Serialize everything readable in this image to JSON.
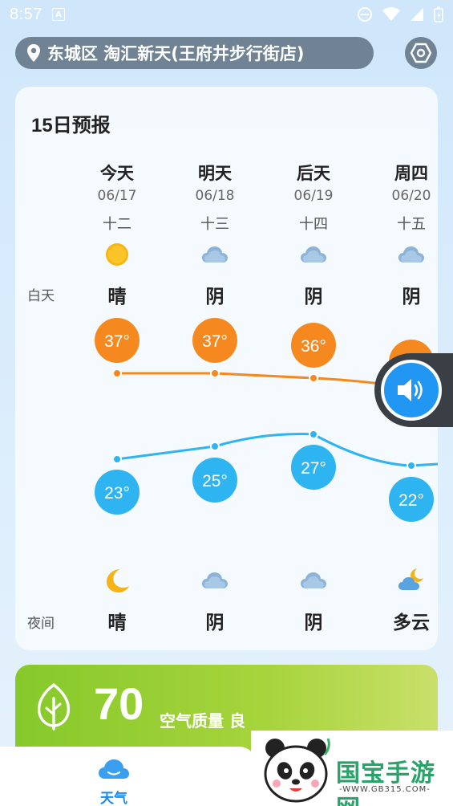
{
  "status": {
    "time": "8:57",
    "badge": "A"
  },
  "location": {
    "text": "东城区 淘汇新天(王府井步行街店)"
  },
  "forecast": {
    "title": "15日预报",
    "day_label": "白天",
    "night_label": "夜间",
    "days": [
      {
        "name": "今天",
        "date": "06/17",
        "lunar": "十二",
        "day_icon": "sun-icon",
        "day_cond": "晴",
        "high": "37°",
        "low": "23°",
        "night_icon": "moon-icon",
        "night_cond": "晴"
      },
      {
        "name": "明天",
        "date": "06/18",
        "lunar": "十三",
        "day_icon": "cloud-icon",
        "day_cond": "阴",
        "high": "37°",
        "low": "25°",
        "night_icon": "cloud-icon",
        "night_cond": "阴"
      },
      {
        "name": "后天",
        "date": "06/19",
        "lunar": "十四",
        "day_icon": "cloud-icon",
        "day_cond": "阴",
        "high": "36°",
        "low": "27°",
        "night_icon": "cloud-icon",
        "night_cond": "阴"
      },
      {
        "name": "周四",
        "date": "06/20",
        "lunar": "十五",
        "day_icon": "cloud-icon",
        "day_cond": "阴",
        "high": "",
        "low": "22°",
        "night_icon": "partly-cloudy-night-icon",
        "night_cond": "多云"
      }
    ],
    "colors": {
      "high": "#f5891f",
      "low": "#2eb4f0"
    }
  },
  "aqi": {
    "value": "70",
    "label": "空气质量 良",
    "color": "#8cc82e"
  },
  "nav": {
    "weather_label": "天气"
  },
  "watermark": {
    "text": "国宝手游网",
    "url": "-WWW.GB315.COM-"
  }
}
